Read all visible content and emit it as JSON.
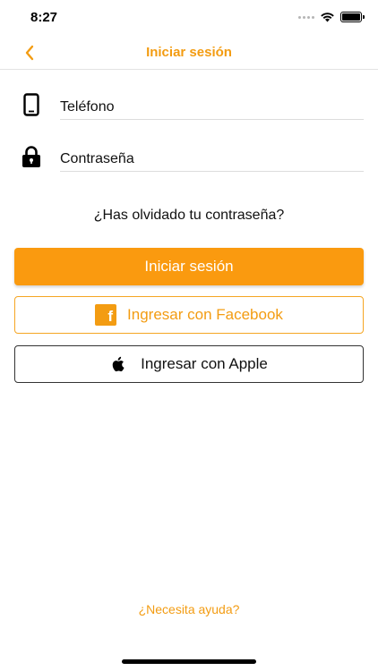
{
  "status_bar": {
    "time": "8:27"
  },
  "header": {
    "title": "Iniciar sesión",
    "back_icon": "chevron-left-icon"
  },
  "form": {
    "phone": {
      "placeholder": "Teléfono",
      "value": "",
      "icon": "phone-icon"
    },
    "password": {
      "placeholder": "Contraseña",
      "value": "",
      "icon": "lock-icon"
    },
    "forgot_password": "¿Has olvidado tu contraseña?"
  },
  "buttons": {
    "login": "Iniciar sesión",
    "facebook": "Ingresar con Facebook",
    "facebook_icon": "facebook-icon",
    "apple": "Ingresar con Apple",
    "apple_icon": "apple-icon"
  },
  "footer": {
    "help": "¿Necesita ayuda?"
  },
  "colors": {
    "accent": "#f39c12",
    "primary_button": "#fa9a0f"
  }
}
